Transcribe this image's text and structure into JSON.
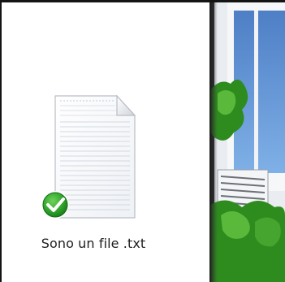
{
  "file": {
    "name": "Sono un file .txt",
    "icon": "text-document-icon",
    "sync_status_icon": "green-checkmark-icon"
  },
  "preview": {
    "image": "house-facade-picture"
  },
  "colors": {
    "sync_ok": "#2fa52b",
    "sky": "#5a8fd4",
    "foliage": "#2e8c1f"
  }
}
